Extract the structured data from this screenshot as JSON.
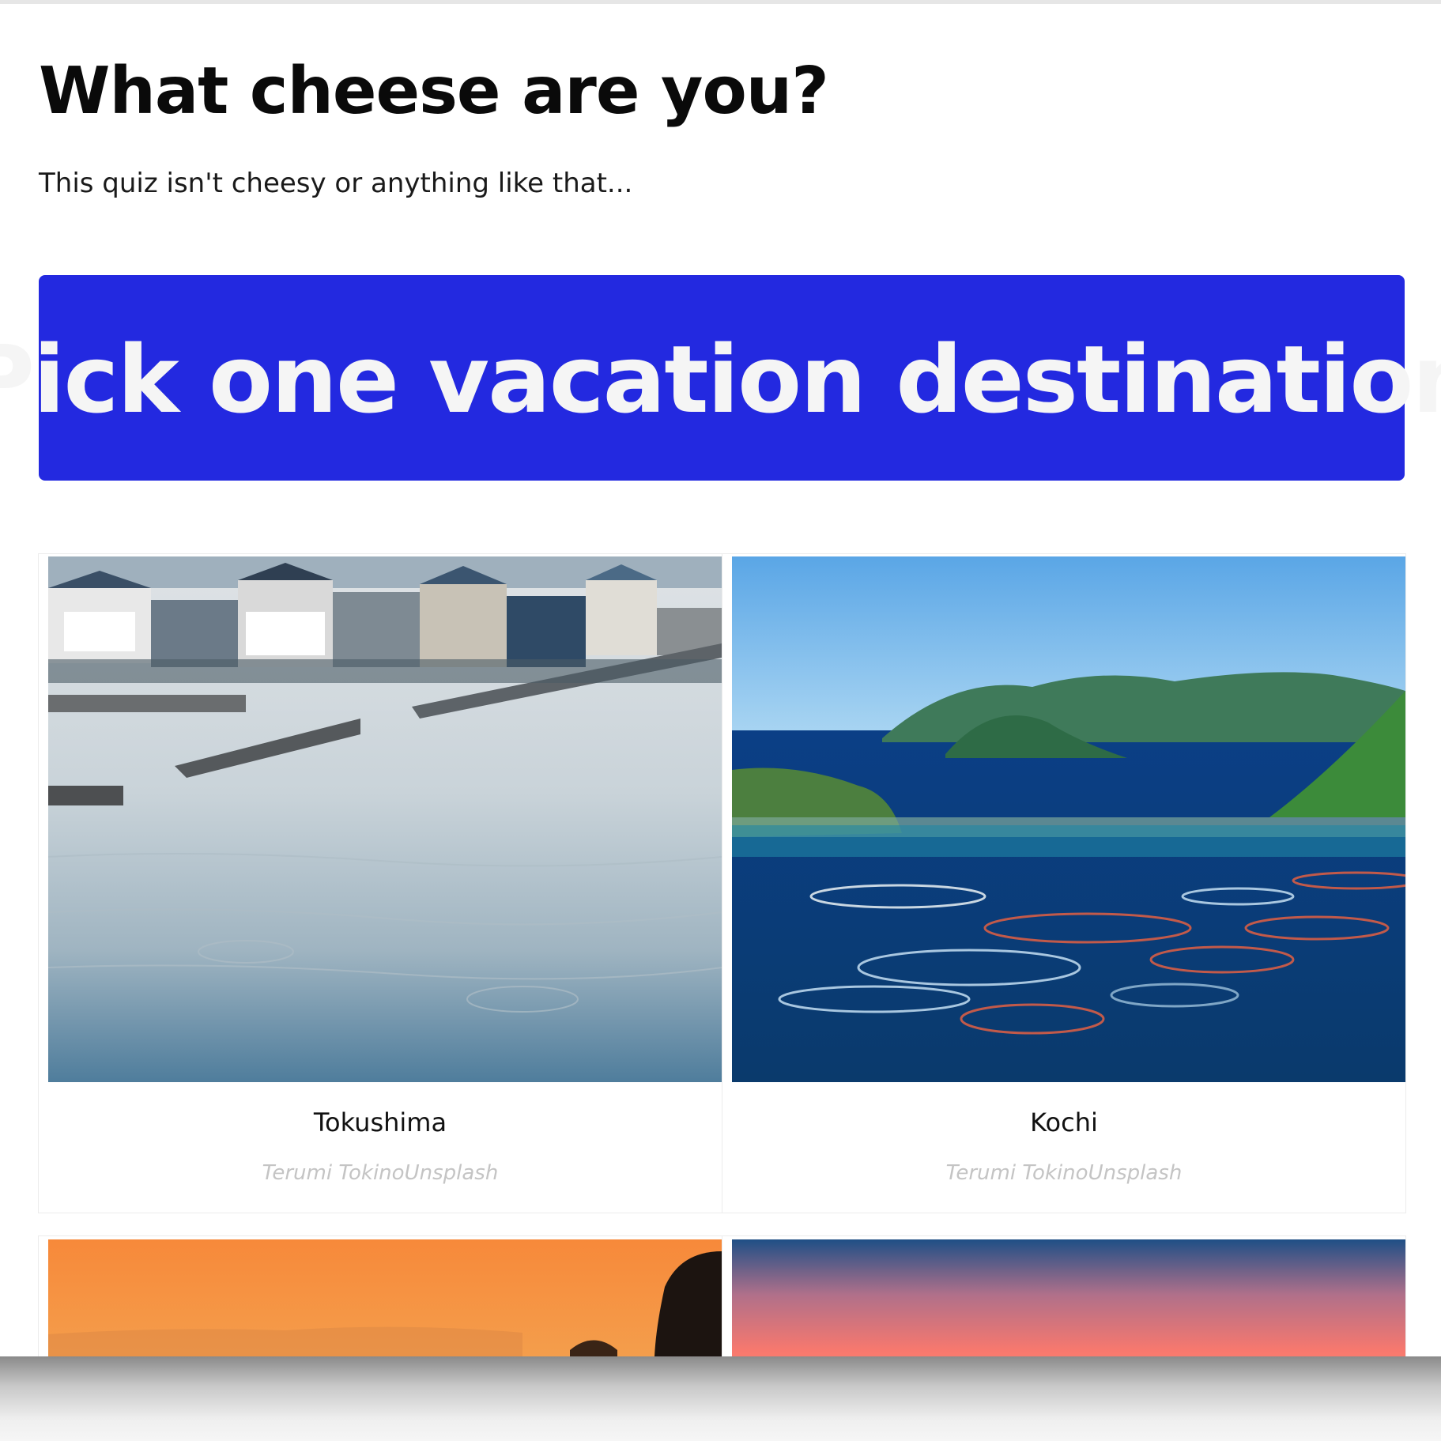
{
  "quiz": {
    "title": "What cheese are you?",
    "subtitle": "This quiz isn't cheesy or anything like that..."
  },
  "question": {
    "text": "Pick one vacation destination",
    "banner_color": "#2329e0"
  },
  "answers": [
    {
      "label": "Tokushima",
      "credit": "Terumi TokinoUnsplash",
      "image": "harbor-town-photo"
    },
    {
      "label": "Kochi",
      "credit": "Terumi TokinoUnsplash",
      "image": "bay-fish-farm-photo"
    },
    {
      "image": "orange-sunset-coast-photo"
    },
    {
      "image": "pink-sky-sunset-photo"
    }
  ]
}
